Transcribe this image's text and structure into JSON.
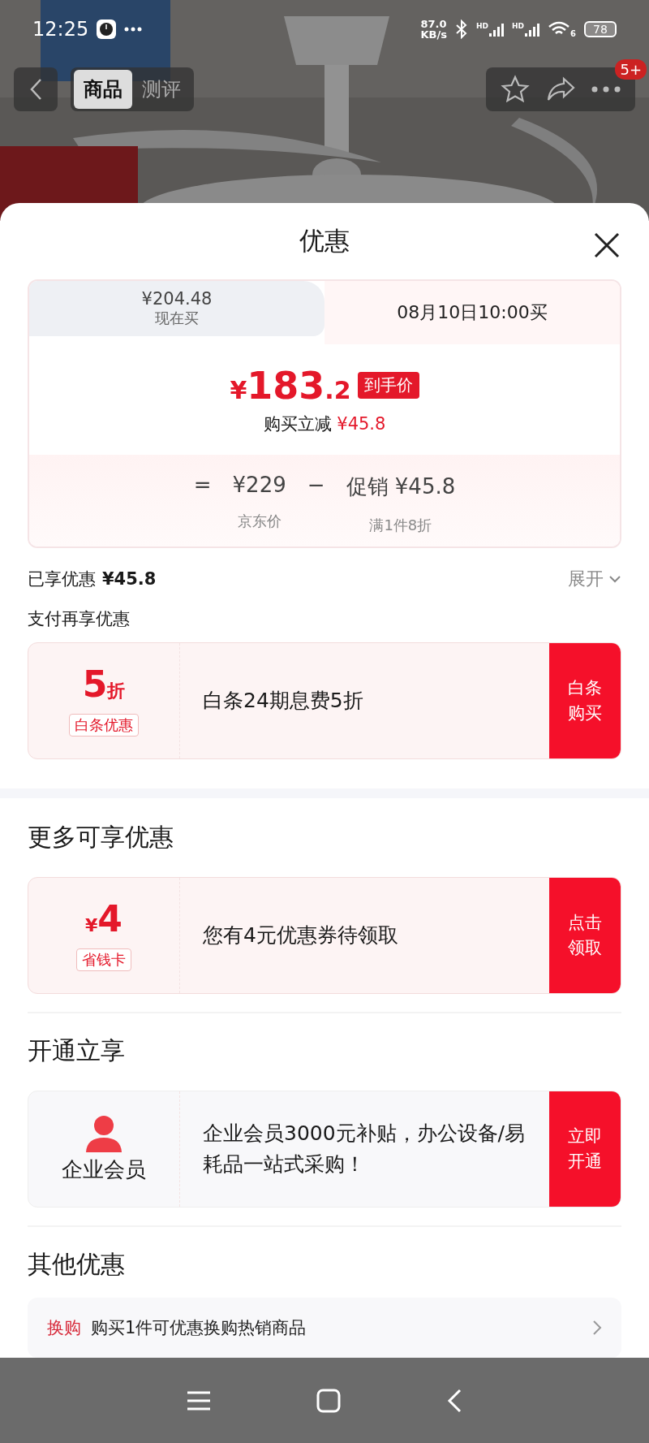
{
  "status_bar": {
    "time": "12:25",
    "net_speed": "87.0",
    "net_unit": "KB/s",
    "signals": [
      {
        "label": "HD"
      },
      {
        "label": "HD"
      }
    ],
    "wifi_label": "6",
    "battery": "78"
  },
  "nav": {
    "tabs": [
      {
        "label": "商品",
        "selected": true
      },
      {
        "label": "测评",
        "selected": false
      }
    ],
    "badge": "5+"
  },
  "sheet": {
    "title": "优惠"
  },
  "price_card": {
    "tabs": [
      {
        "price": "¥204.48",
        "label": "现在买",
        "selected": false
      },
      {
        "label": "08月10日10:00买",
        "selected": true
      }
    ],
    "final_price": {
      "currency": "¥",
      "integer": "183",
      "decimal": ".2",
      "tag": "到手价"
    },
    "saving": {
      "label": "购买立减",
      "amount": "¥45.8"
    },
    "formula": [
      {
        "kind": "op",
        "text": "="
      },
      {
        "kind": "term",
        "value": "¥229",
        "caption": "京东价"
      },
      {
        "kind": "op",
        "text": "−"
      },
      {
        "kind": "term",
        "label": "促销",
        "value": "¥45.8",
        "caption": "满1件8折"
      }
    ]
  },
  "enjoyed": {
    "label": "已享优惠",
    "amount": "¥45.8",
    "toggle": "展开"
  },
  "sections": [
    {
      "kind": "sub",
      "title": "支付再享优惠",
      "cards": [
        {
          "kind": "discount",
          "big": "5",
          "unit": "折",
          "tag": "白条优惠",
          "text": "白条24期息费5折",
          "action": "白条购买"
        }
      ]
    },
    {
      "kind": "heading",
      "title": "更多可享优惠",
      "cards": [
        {
          "kind": "coupon",
          "currency": "¥",
          "big": "4",
          "tag": "省钱卡",
          "text": "您有4元优惠券待领取",
          "action": "点击领取"
        }
      ]
    },
    {
      "kind": "heading",
      "title": "开通立享",
      "cards": [
        {
          "kind": "member",
          "name": "企业会员",
          "text": "企业会员3000元补贴，办公设备/易耗品一站式采购！",
          "action": "立即开通"
        }
      ]
    },
    {
      "kind": "heading",
      "title": "其他优惠",
      "rows": [
        {
          "tag": "换购",
          "text": "购买1件可优惠换购热销商品"
        }
      ]
    }
  ]
}
